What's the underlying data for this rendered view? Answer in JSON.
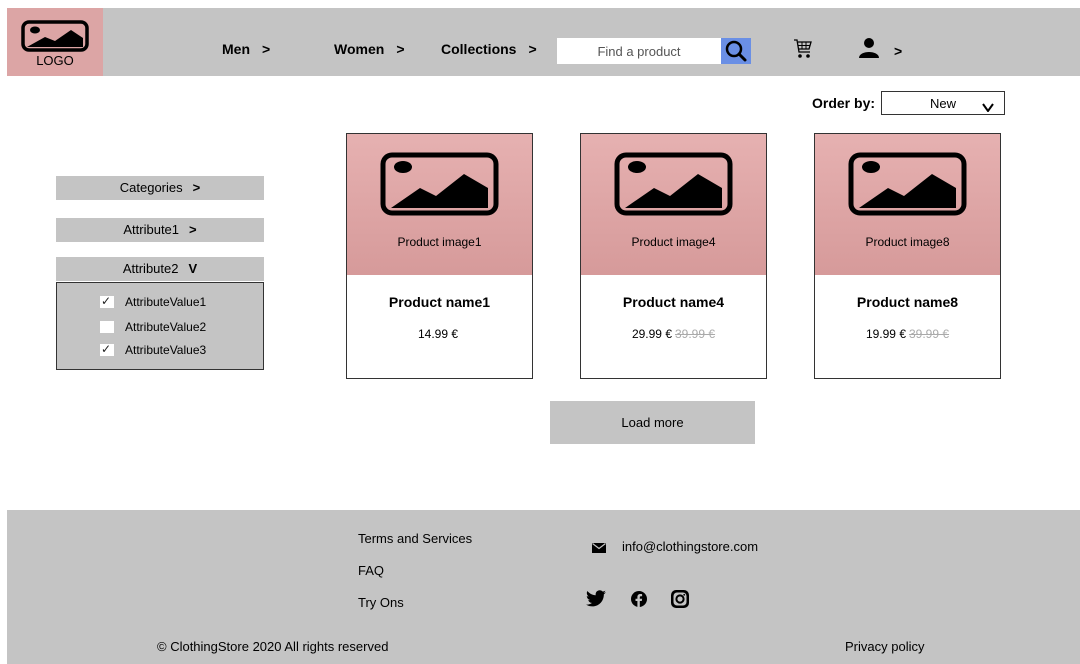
{
  "header": {
    "logo_text": "LOGO",
    "nav": [
      {
        "label": "Men",
        "chevron": ">"
      },
      {
        "label": "Women",
        "chevron": ">"
      },
      {
        "label": "Collections",
        "chevron": ">"
      }
    ],
    "search_placeholder": "Find a product",
    "user_chevron": ">"
  },
  "order_by": {
    "label": "Order by:",
    "selected": "New"
  },
  "filters": {
    "categories": {
      "label": "Categories",
      "chevron": ">"
    },
    "attribute1": {
      "label": "Attribute1",
      "chevron": ">"
    },
    "attribute2": {
      "label": "Attribute2",
      "chevron": "V",
      "values": [
        {
          "label": "AttributeValue1",
          "checked": true
        },
        {
          "label": "AttributeValue2",
          "checked": false
        },
        {
          "label": "AttributeValue3",
          "checked": true
        }
      ]
    }
  },
  "products": [
    {
      "image_caption": "Product image1",
      "name": "Product name1",
      "price": "14.99 €",
      "old_price": ""
    },
    {
      "image_caption": "Product image4",
      "name": "Product name4",
      "price": "29.99 €",
      "old_price": "39.99 €"
    },
    {
      "image_caption": "Product image8",
      "name": "Product name8",
      "price": "19.99 €",
      "old_price": "39.99 €"
    }
  ],
  "load_more_label": "Load more",
  "footer": {
    "links": [
      "Terms and Services",
      "FAQ",
      "Try Ons"
    ],
    "email": "info@clothingstore.com",
    "copyright": "© ClothingStore 2020 All rights reserved",
    "privacy": "Privacy policy"
  },
  "colors": {
    "gray": "#c4c4c4",
    "logo_pink": "#dca5a5",
    "image_pink": "#e0a8a8",
    "search_button": "#6a8fe5"
  },
  "icons": [
    "image-placeholder-icon",
    "search-icon",
    "cart-icon",
    "user-icon",
    "mail-icon",
    "twitter-icon",
    "facebook-icon",
    "instagram-icon"
  ]
}
